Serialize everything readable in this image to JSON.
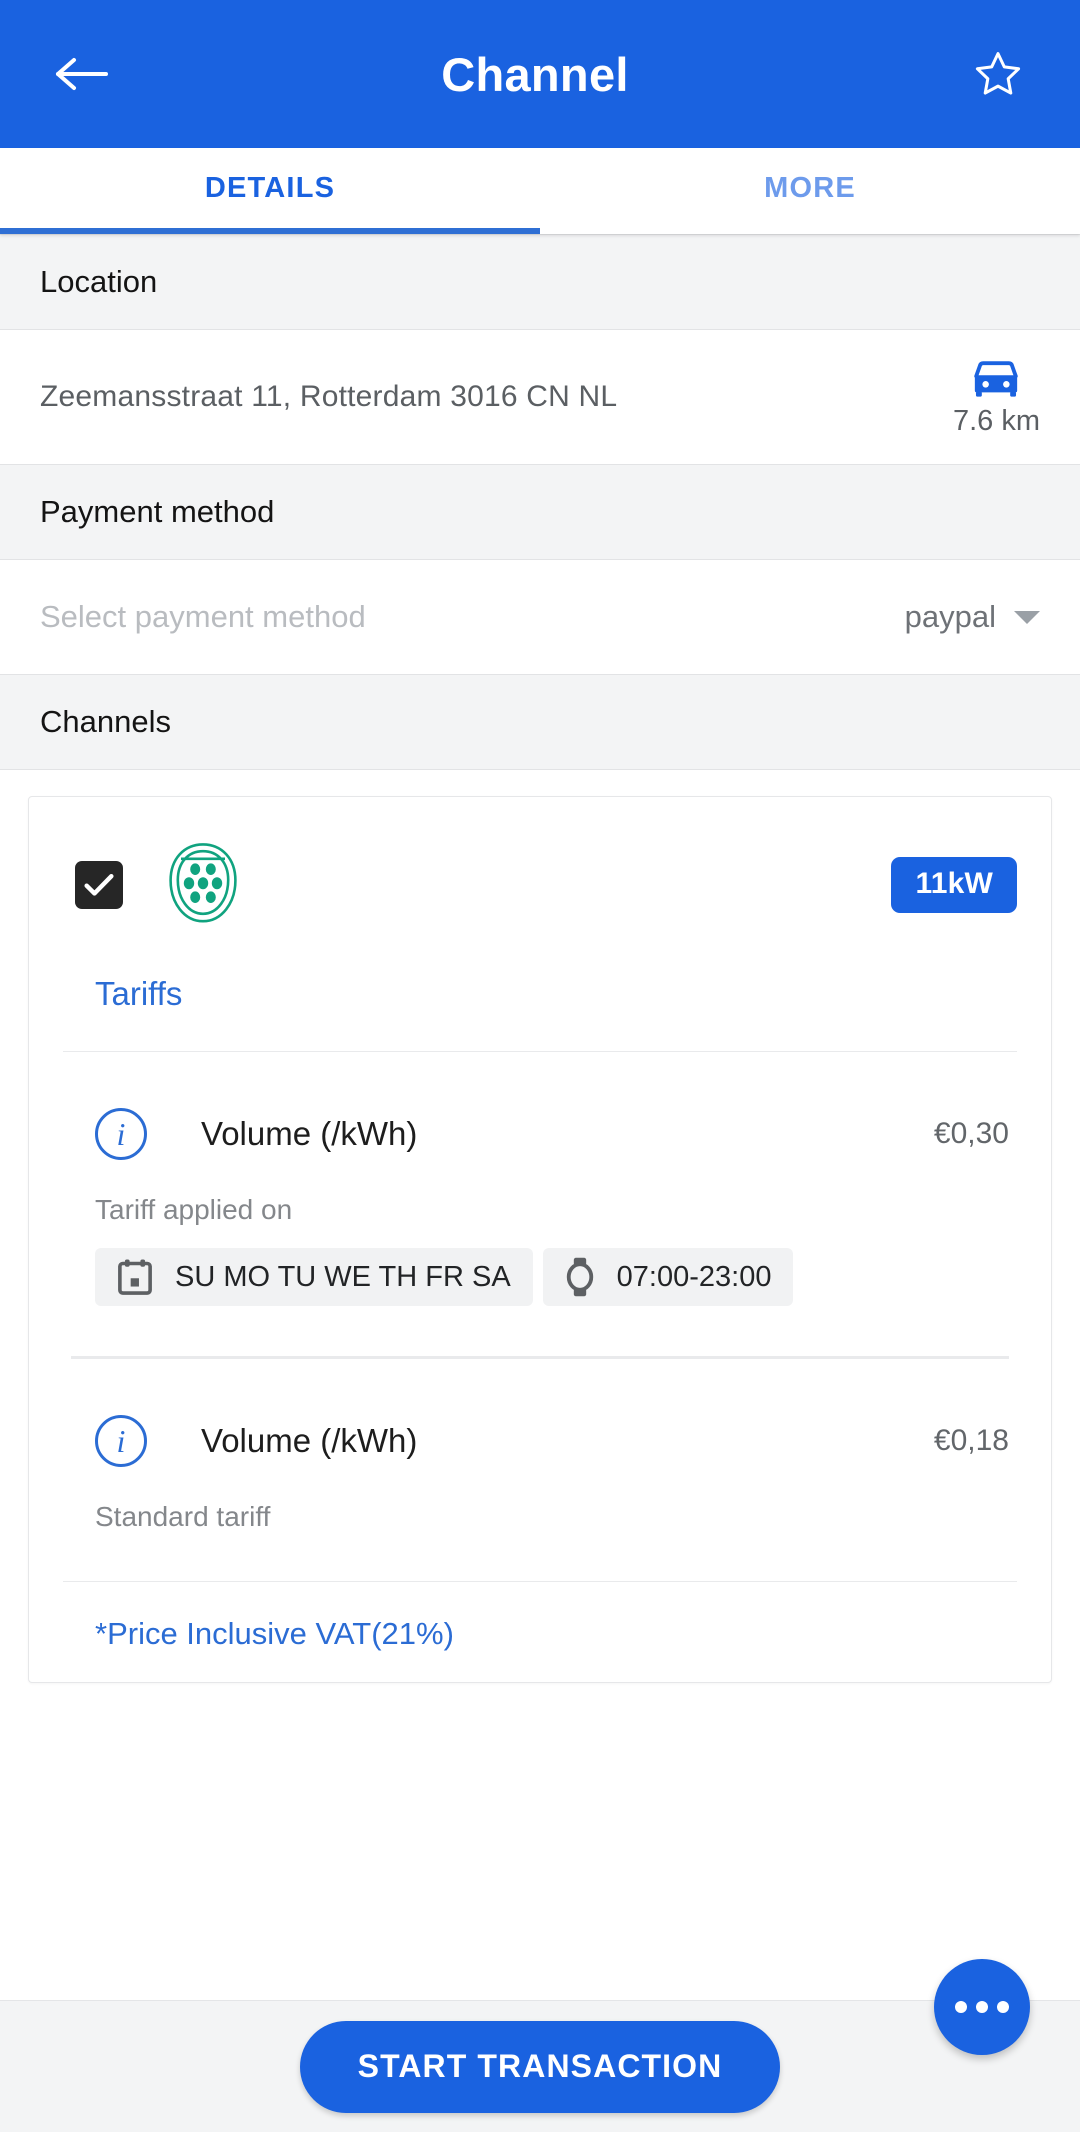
{
  "appbar": {
    "title": "Channel",
    "back_icon": "arrow-left-icon",
    "favorite_icon": "star-outline-icon"
  },
  "tabs": [
    {
      "label": "DETAILS",
      "active": true
    },
    {
      "label": "MORE",
      "active": false
    }
  ],
  "location": {
    "section_title": "Location",
    "address": "Zeemansstraat 11, Rotterdam 3016 CN NL",
    "distance": "7.6 km",
    "distance_icon": "car-icon"
  },
  "payment": {
    "section_title": "Payment method",
    "placeholder": "Select payment method",
    "selected": "paypal",
    "dropdown_icon": "caret-down-icon"
  },
  "channels": {
    "section_title": "Channels",
    "card": {
      "checked": true,
      "checkbox_icon": "checkmark-icon",
      "connector_icon": "type2-connector-icon",
      "power_badge": "11kW",
      "tariffs_title": "Tariffs",
      "tariffs": [
        {
          "info_icon": "info-circle-icon",
          "name": "Volume (/kWh)",
          "price": "€0,30",
          "applied_label": "Tariff applied on",
          "chips": [
            {
              "icon": "calendar-icon",
              "text": "SU MO TU WE TH FR SA"
            },
            {
              "icon": "watch-icon",
              "text": "07:00-23:00"
            }
          ]
        },
        {
          "info_icon": "info-circle-icon",
          "name": "Volume (/kWh)",
          "price": "€0,18",
          "applied_label": "Standard tariff",
          "chips": []
        }
      ],
      "vat_note": "*Price Inclusive VAT(21%)"
    }
  },
  "bottom": {
    "start_label": "START TRANSACTION",
    "more_icon": "overflow-dots-icon"
  },
  "colors": {
    "primary": "#1a62e0",
    "connector_green": "#10a37f",
    "section_bg": "#f3f4f5"
  }
}
